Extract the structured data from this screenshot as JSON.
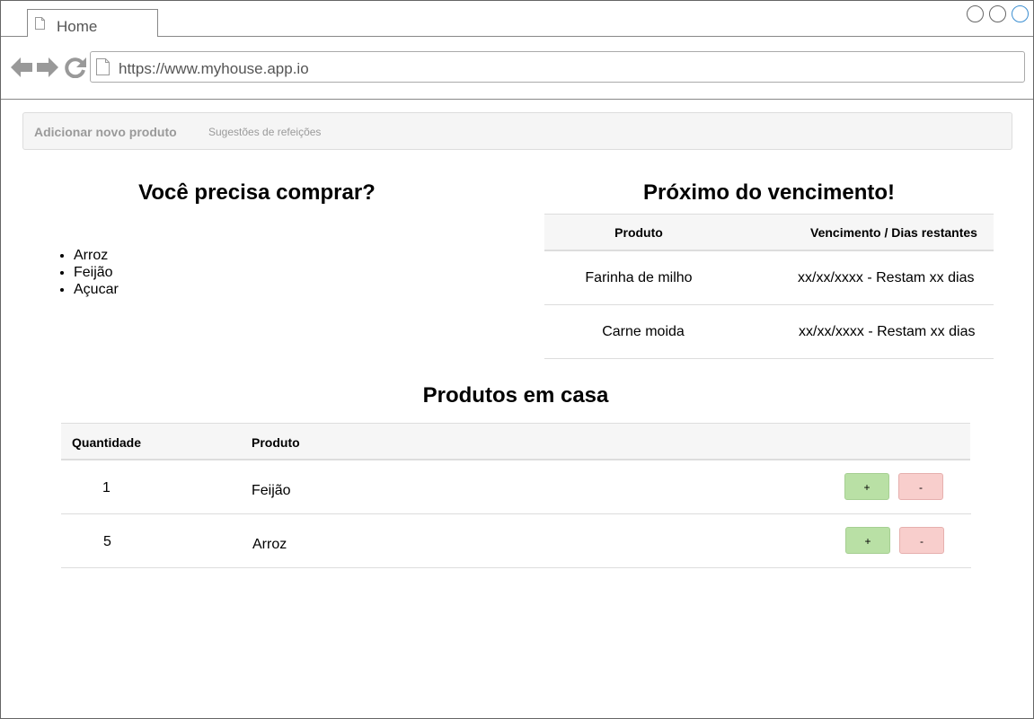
{
  "browser": {
    "tab_title": "Home",
    "url": "https://www.myhouse.app.io"
  },
  "navbar": {
    "add_product": "Adicionar novo produto",
    "meal_suggestions": "Sugestões de refeições"
  },
  "shopping": {
    "title": "Você precisa comprar?",
    "items": [
      "Arroz",
      "Feijão",
      "Açucar"
    ]
  },
  "expiring": {
    "title": "Próximo do vencimento!",
    "headers": {
      "product": "Produto",
      "expiry": "Vencimento / Dias restantes"
    },
    "rows": [
      {
        "product": "Farinha de milho",
        "expiry": "xx/xx/xxxx - Restam xx dias"
      },
      {
        "product": "Carne moida",
        "expiry": "xx/xx/xxxx - Restam xx dias"
      }
    ]
  },
  "inventory": {
    "title": "Produtos em casa",
    "headers": {
      "quantity": "Quantidade",
      "product": "Produto"
    },
    "rows": [
      {
        "quantity": "1",
        "product": "Feijão"
      },
      {
        "quantity": "5",
        "product": "Arroz"
      }
    ],
    "plus_label": "+",
    "minus_label": "-"
  }
}
